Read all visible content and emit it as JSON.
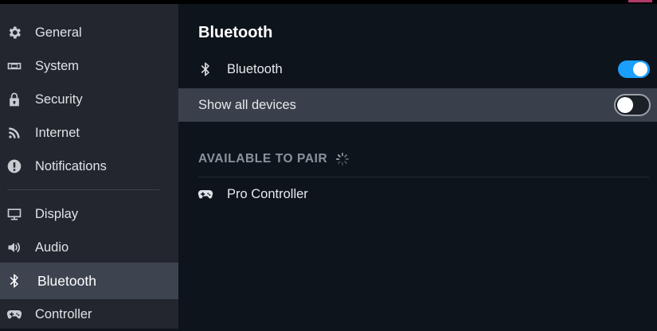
{
  "sidebar": {
    "items": [
      {
        "label": "General",
        "icon": "gear-icon"
      },
      {
        "label": "System",
        "icon": "deck-icon"
      },
      {
        "label": "Security",
        "icon": "lock-icon"
      },
      {
        "label": "Internet",
        "icon": "wifi-icon"
      },
      {
        "label": "Notifications",
        "icon": "alert-icon"
      },
      {
        "label": "Display",
        "icon": "monitor-icon"
      },
      {
        "label": "Audio",
        "icon": "speaker-icon"
      },
      {
        "label": "Bluetooth",
        "icon": "bluetooth-icon",
        "active": true
      },
      {
        "label": "Controller",
        "icon": "gamepad-icon"
      }
    ]
  },
  "main": {
    "title": "Bluetooth",
    "bluetooth_row": {
      "label": "Bluetooth",
      "enabled": true
    },
    "show_all_row": {
      "label": "Show all devices",
      "enabled": false
    },
    "available_header": "AVAILABLE TO PAIR",
    "devices": [
      {
        "label": "Pro Controller",
        "icon": "gamepad-icon"
      }
    ]
  },
  "colors": {
    "accent": "#1a9fff",
    "sidebar_bg": "#23262e",
    "main_bg": "#0e141b",
    "active_item_bg": "#3d4450",
    "highlight_row_bg": "#3a404b"
  }
}
